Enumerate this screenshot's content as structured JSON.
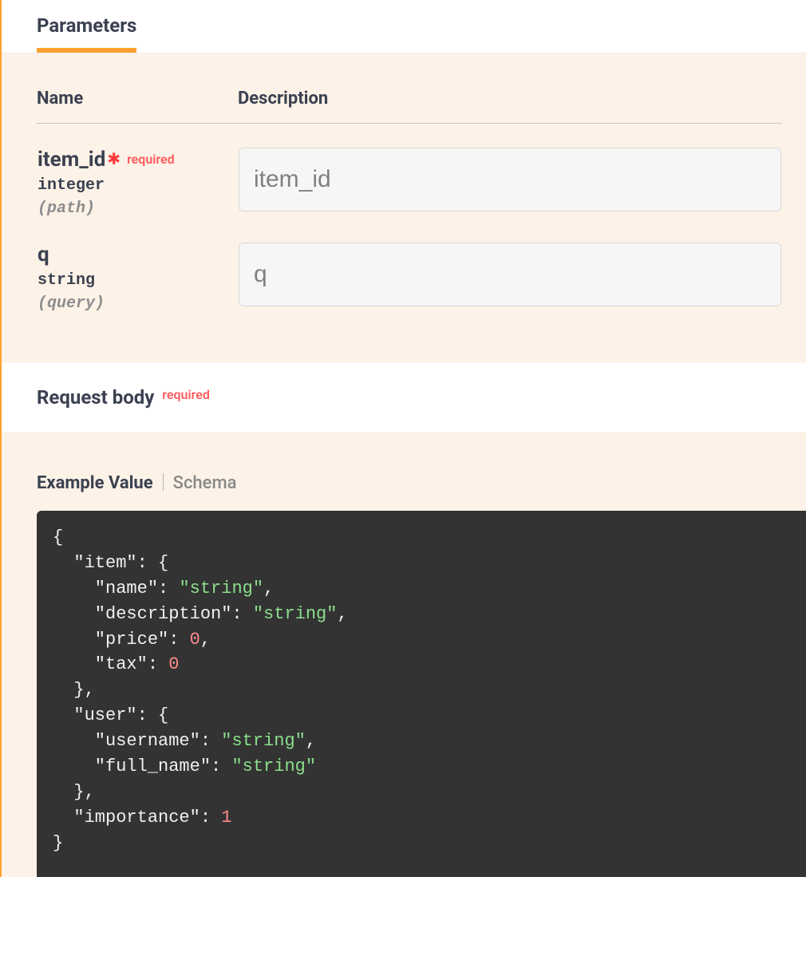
{
  "tabs": {
    "parameters": "Parameters"
  },
  "headers": {
    "name": "Name",
    "description": "Description"
  },
  "params": [
    {
      "name": "item_id",
      "required": true,
      "required_label": "required",
      "type": "integer",
      "in": "(path)",
      "placeholder": "item_id"
    },
    {
      "name": "q",
      "required": false,
      "required_label": "",
      "type": "string",
      "in": "(query)",
      "placeholder": "q"
    }
  ],
  "request_body": {
    "title": "Request body",
    "required_label": "required",
    "tab_example": "Example Value",
    "tab_schema": "Schema"
  },
  "example_json": {
    "item": {
      "name": "string",
      "description": "string",
      "price": 0,
      "tax": 0
    },
    "user": {
      "username": "string",
      "full_name": "string"
    },
    "importance": 1
  }
}
